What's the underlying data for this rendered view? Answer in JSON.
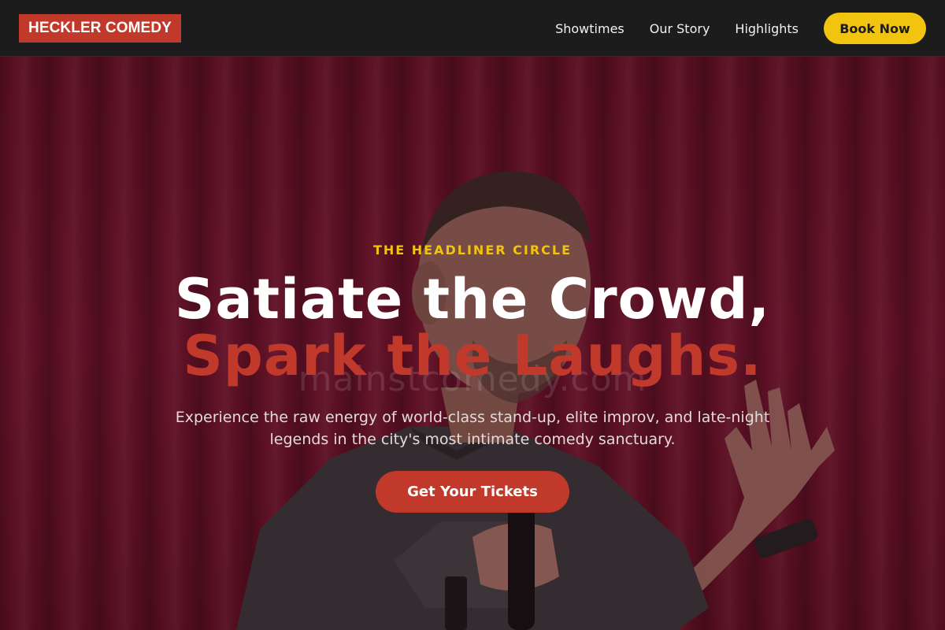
{
  "brand": {
    "logo_text": "HECKLER COMEDY",
    "accent": "#c0392b",
    "highlight": "#f1c40f"
  },
  "nav": {
    "links": [
      "Showtimes",
      "Our Story",
      "Highlights"
    ],
    "cta_label": "Book Now"
  },
  "hero": {
    "eyebrow": "THE HEADLINER CIRCLE",
    "headline_line1": "Satiate the Crowd,",
    "headline_line2": "Spark the Laughs.",
    "watermark": "mainstcomedy.com",
    "subtext": "Experience the raw energy of world-class stand-up, elite improv, and late-night legends in the city's most intimate comedy sanctuary.",
    "cta_label": "Get Your Tickets",
    "background_image": "comedian-on-stage-with-microphone-red-curtain"
  }
}
